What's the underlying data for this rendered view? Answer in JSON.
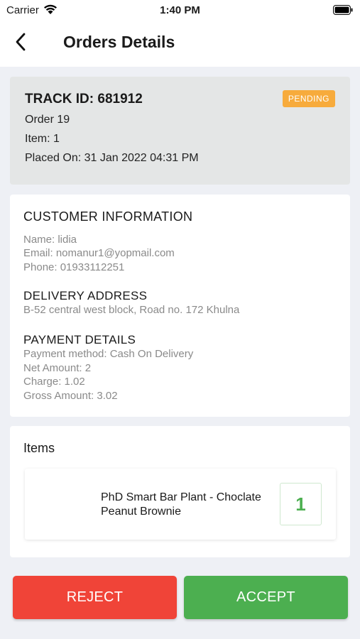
{
  "status_bar": {
    "carrier": "Carrier",
    "time": "1:40 PM"
  },
  "header": {
    "title": "Orders Details",
    "back_icon": "chevron-left-icon"
  },
  "order": {
    "track_id": "TRACK ID: 681912",
    "status": "PENDING",
    "order_no": "Order 19",
    "item_count": "Item: 1",
    "placed_on": "Placed On: 31 Jan 2022 04:31 PM"
  },
  "customer": {
    "heading": "CUSTOMER INFORMATION",
    "name": "Name: lidia",
    "email": "Email: nomanur1@yopmail.com",
    "phone": "Phone: 01933112251"
  },
  "delivery": {
    "heading": "DELIVERY ADDRESS",
    "address": "B-52 central west block, Road no. 172 Khulna"
  },
  "payment": {
    "heading": "PAYMENT DETAILS",
    "method": "Payment method: Cash On Delivery",
    "net": "Net Amount: 2",
    "charge": "Charge: 1.02",
    "gross": "Gross Amount: 3.02"
  },
  "items": {
    "heading": "Items",
    "list": [
      {
        "name": "PhD Smart Bar Plant - Choclate Peanut Brownie",
        "qty": "1"
      }
    ]
  },
  "actions": {
    "reject": "REJECT",
    "accept": "ACCEPT"
  },
  "colors": {
    "pending": "#f7ab3c",
    "reject": "#f04438",
    "accept": "#4caf50"
  }
}
